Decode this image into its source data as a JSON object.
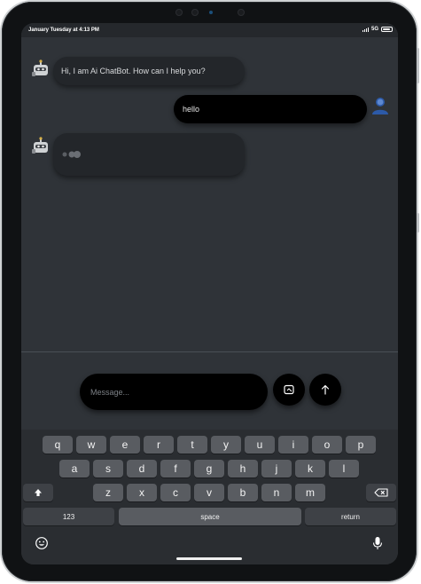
{
  "status_bar": {
    "time": "January Tuesday at 4:13 PM",
    "network": "5G"
  },
  "messages": [
    {
      "sender": "bot",
      "text": "Hi, I am Ai ChatBot. How can I help you?"
    },
    {
      "sender": "user",
      "text": "hello"
    },
    {
      "sender": "bot",
      "text": "",
      "typing": true
    }
  ],
  "composer": {
    "placeholder": "Message...",
    "attach_icon": "image-icon",
    "send_icon": "arrow-up-icon"
  },
  "keyboard": {
    "row1": [
      "q",
      "w",
      "e",
      "r",
      "t",
      "y",
      "u",
      "i",
      "o",
      "p"
    ],
    "row2": [
      "a",
      "s",
      "d",
      "f",
      "g",
      "h",
      "j",
      "k",
      "l"
    ],
    "row3": [
      "z",
      "x",
      "c",
      "v",
      "b",
      "n",
      "m"
    ],
    "numbers_label": "123",
    "space_label": "space",
    "return_label": "return",
    "shift_icon": "shift-icon",
    "backspace_icon": "backspace-icon",
    "emoji_icon": "emoji-icon",
    "mic_icon": "microphone-icon"
  },
  "colors": {
    "screen_bg": "#2f3338",
    "bubble_bot": "#23262a",
    "bubble_user": "#000000",
    "key": "#595c61"
  }
}
